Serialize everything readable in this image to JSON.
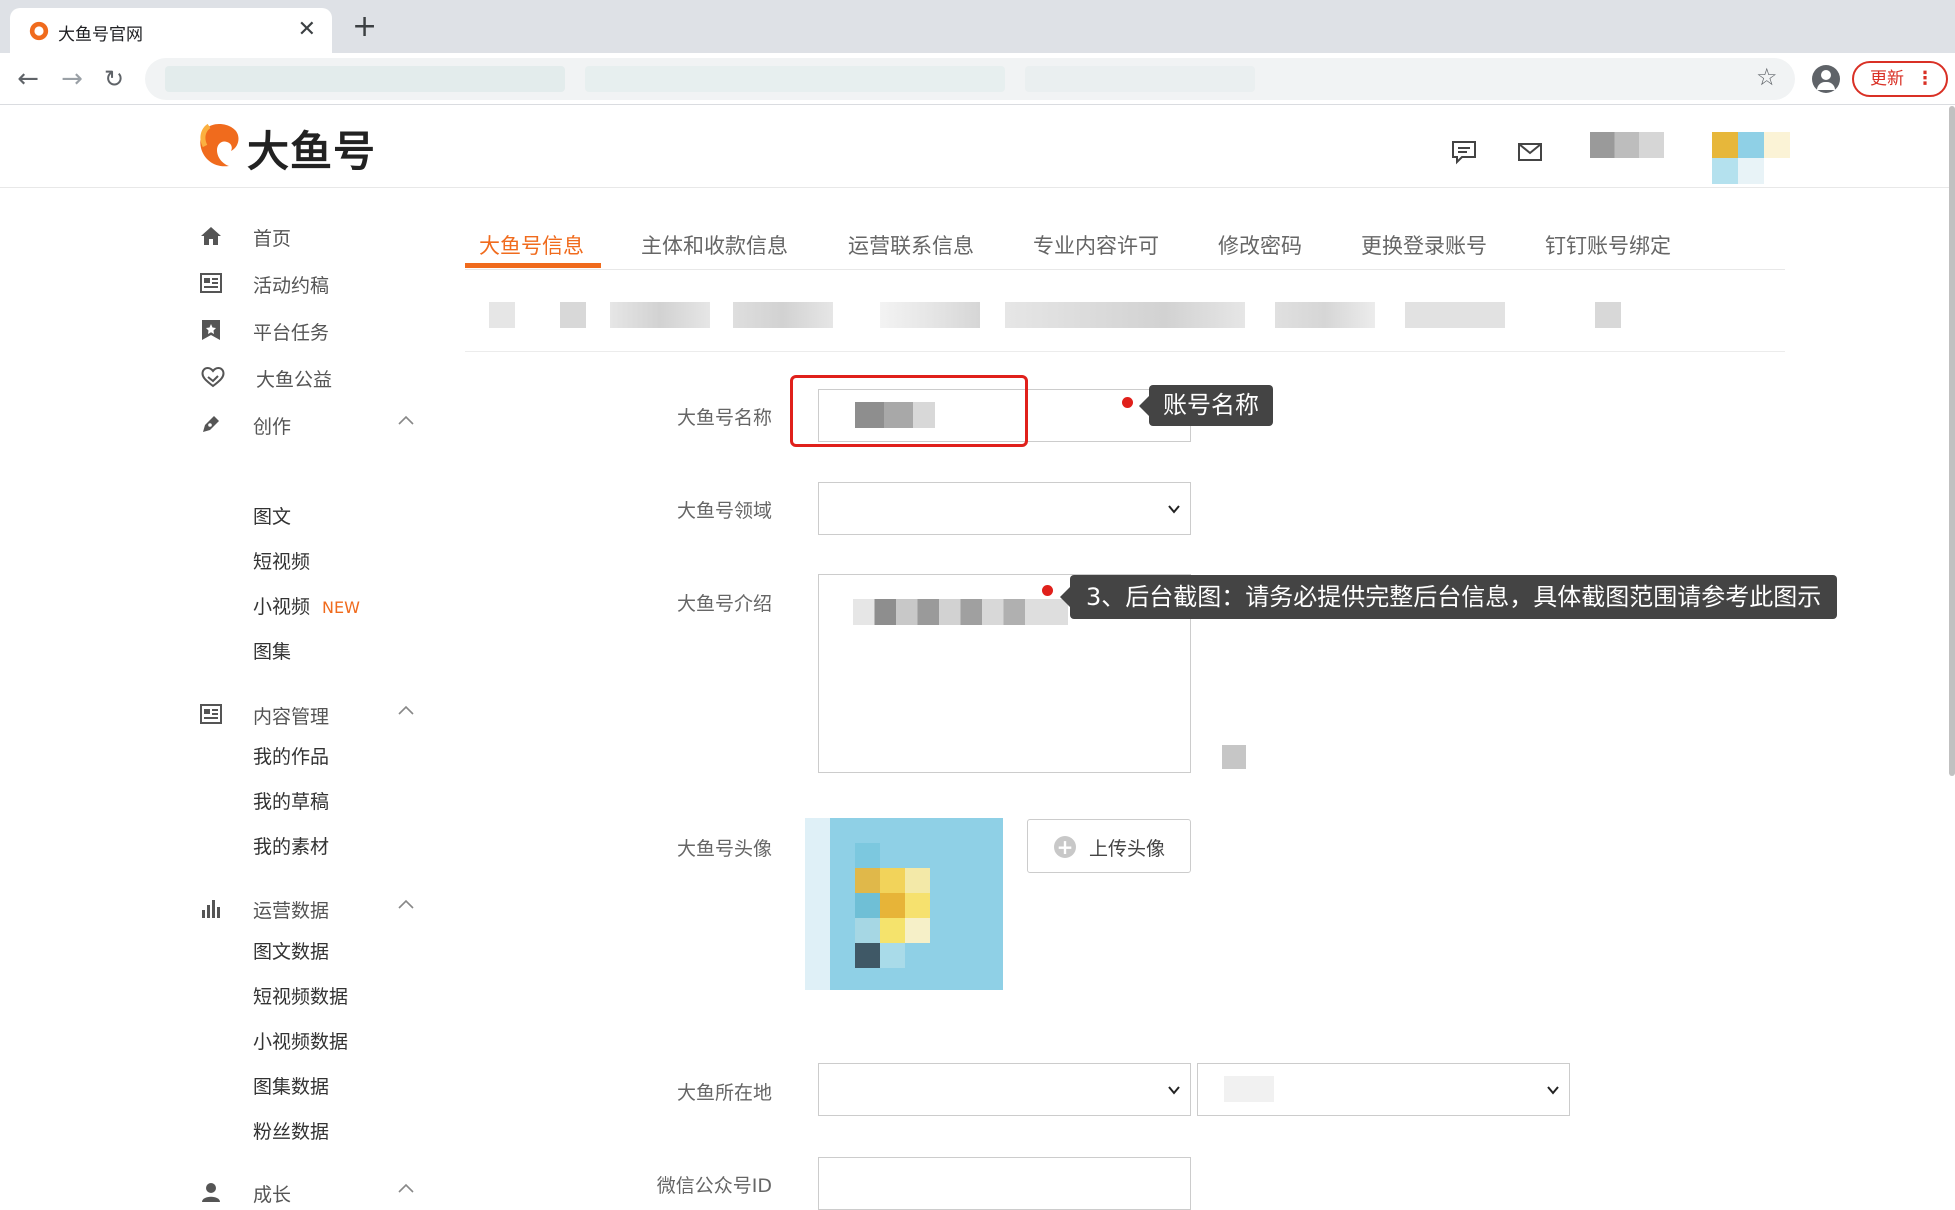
{
  "browser": {
    "tab_title": "大鱼号官网",
    "update_label": "更新"
  },
  "site": {
    "logo_text": "大鱼号",
    "brand_color": "#f06b1d"
  },
  "sidebar": {
    "home": "首页",
    "activities": "活动约稿",
    "platform_tasks": "平台任务",
    "charity": "大鱼公益",
    "create": {
      "label": "创作",
      "items": [
        "图文",
        "短视频",
        "小视频",
        "图集"
      ],
      "new_badge": "NEW"
    },
    "content": {
      "label": "内容管理",
      "items": [
        "我的作品",
        "我的草稿",
        "我的素材"
      ]
    },
    "ops_data": {
      "label": "运营数据",
      "items": [
        "图文数据",
        "短视频数据",
        "小视频数据",
        "图集数据",
        "粉丝数据"
      ]
    },
    "growth": "成长"
  },
  "tabs": [
    "大鱼号信息",
    "主体和收款信息",
    "运营联系信息",
    "专业内容许可",
    "修改密码",
    "更换登录账号",
    "钉钉账号绑定"
  ],
  "form": {
    "name_label": "大鱼号名称",
    "field_label": "大鱼号领域",
    "intro_label": "大鱼号介绍",
    "avatar_label": "大鱼号头像",
    "upload_label": "上传头像",
    "location_label": "大鱼所在地",
    "wechat_label": "微信公众号ID"
  },
  "annotations": {
    "name_callout": "账号名称",
    "screenshot_callout": "3、后台截图：请务必提供完整后台信息，具体截图范围请参考此图示",
    "highlight_color": "#e0201b"
  }
}
